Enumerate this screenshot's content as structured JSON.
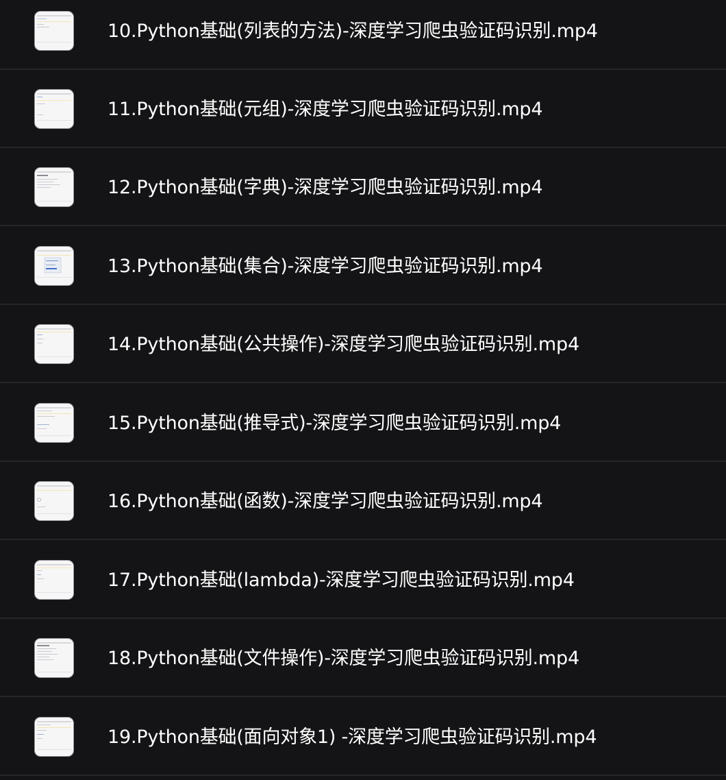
{
  "files": [
    {
      "name": "10.Python基础(列表的方法)-深度学习爬虫验证码识别.mp4",
      "thumbnail_icon": "video-thumbnail-icon"
    },
    {
      "name": "11.Python基础(元组)-深度学习爬虫验证码识别.mp4",
      "thumbnail_icon": "video-thumbnail-icon"
    },
    {
      "name": "12.Python基础(字典)-深度学习爬虫验证码识别.mp4",
      "thumbnail_icon": "video-thumbnail-icon"
    },
    {
      "name": "13.Python基础(集合)-深度学习爬虫验证码识别.mp4",
      "thumbnail_icon": "video-thumbnail-icon"
    },
    {
      "name": "14.Python基础(公共操作)-深度学习爬虫验证码识别.mp4",
      "thumbnail_icon": "video-thumbnail-icon"
    },
    {
      "name": "15.Python基础(推导式)-深度学习爬虫验证码识别.mp4",
      "thumbnail_icon": "video-thumbnail-icon"
    },
    {
      "name": "16.Python基础(函数)-深度学习爬虫验证码识别.mp4",
      "thumbnail_icon": "video-thumbnail-icon"
    },
    {
      "name": "17.Python基础(lambda)-深度学习爬虫验证码识别.mp4",
      "thumbnail_icon": "video-thumbnail-icon"
    },
    {
      "name": "18.Python基础(文件操作)-深度学习爬虫验证码识别.mp4",
      "thumbnail_icon": "video-thumbnail-icon"
    },
    {
      "name": "19.Python基础(面向对象1) -深度学习爬虫验证码识别.mp4",
      "thumbnail_icon": "video-thumbnail-icon"
    }
  ],
  "colors": {
    "background": "#141416",
    "divider": "#26262a",
    "text": "#ffffff",
    "thumbnail_bg": "#f6f6f7"
  }
}
